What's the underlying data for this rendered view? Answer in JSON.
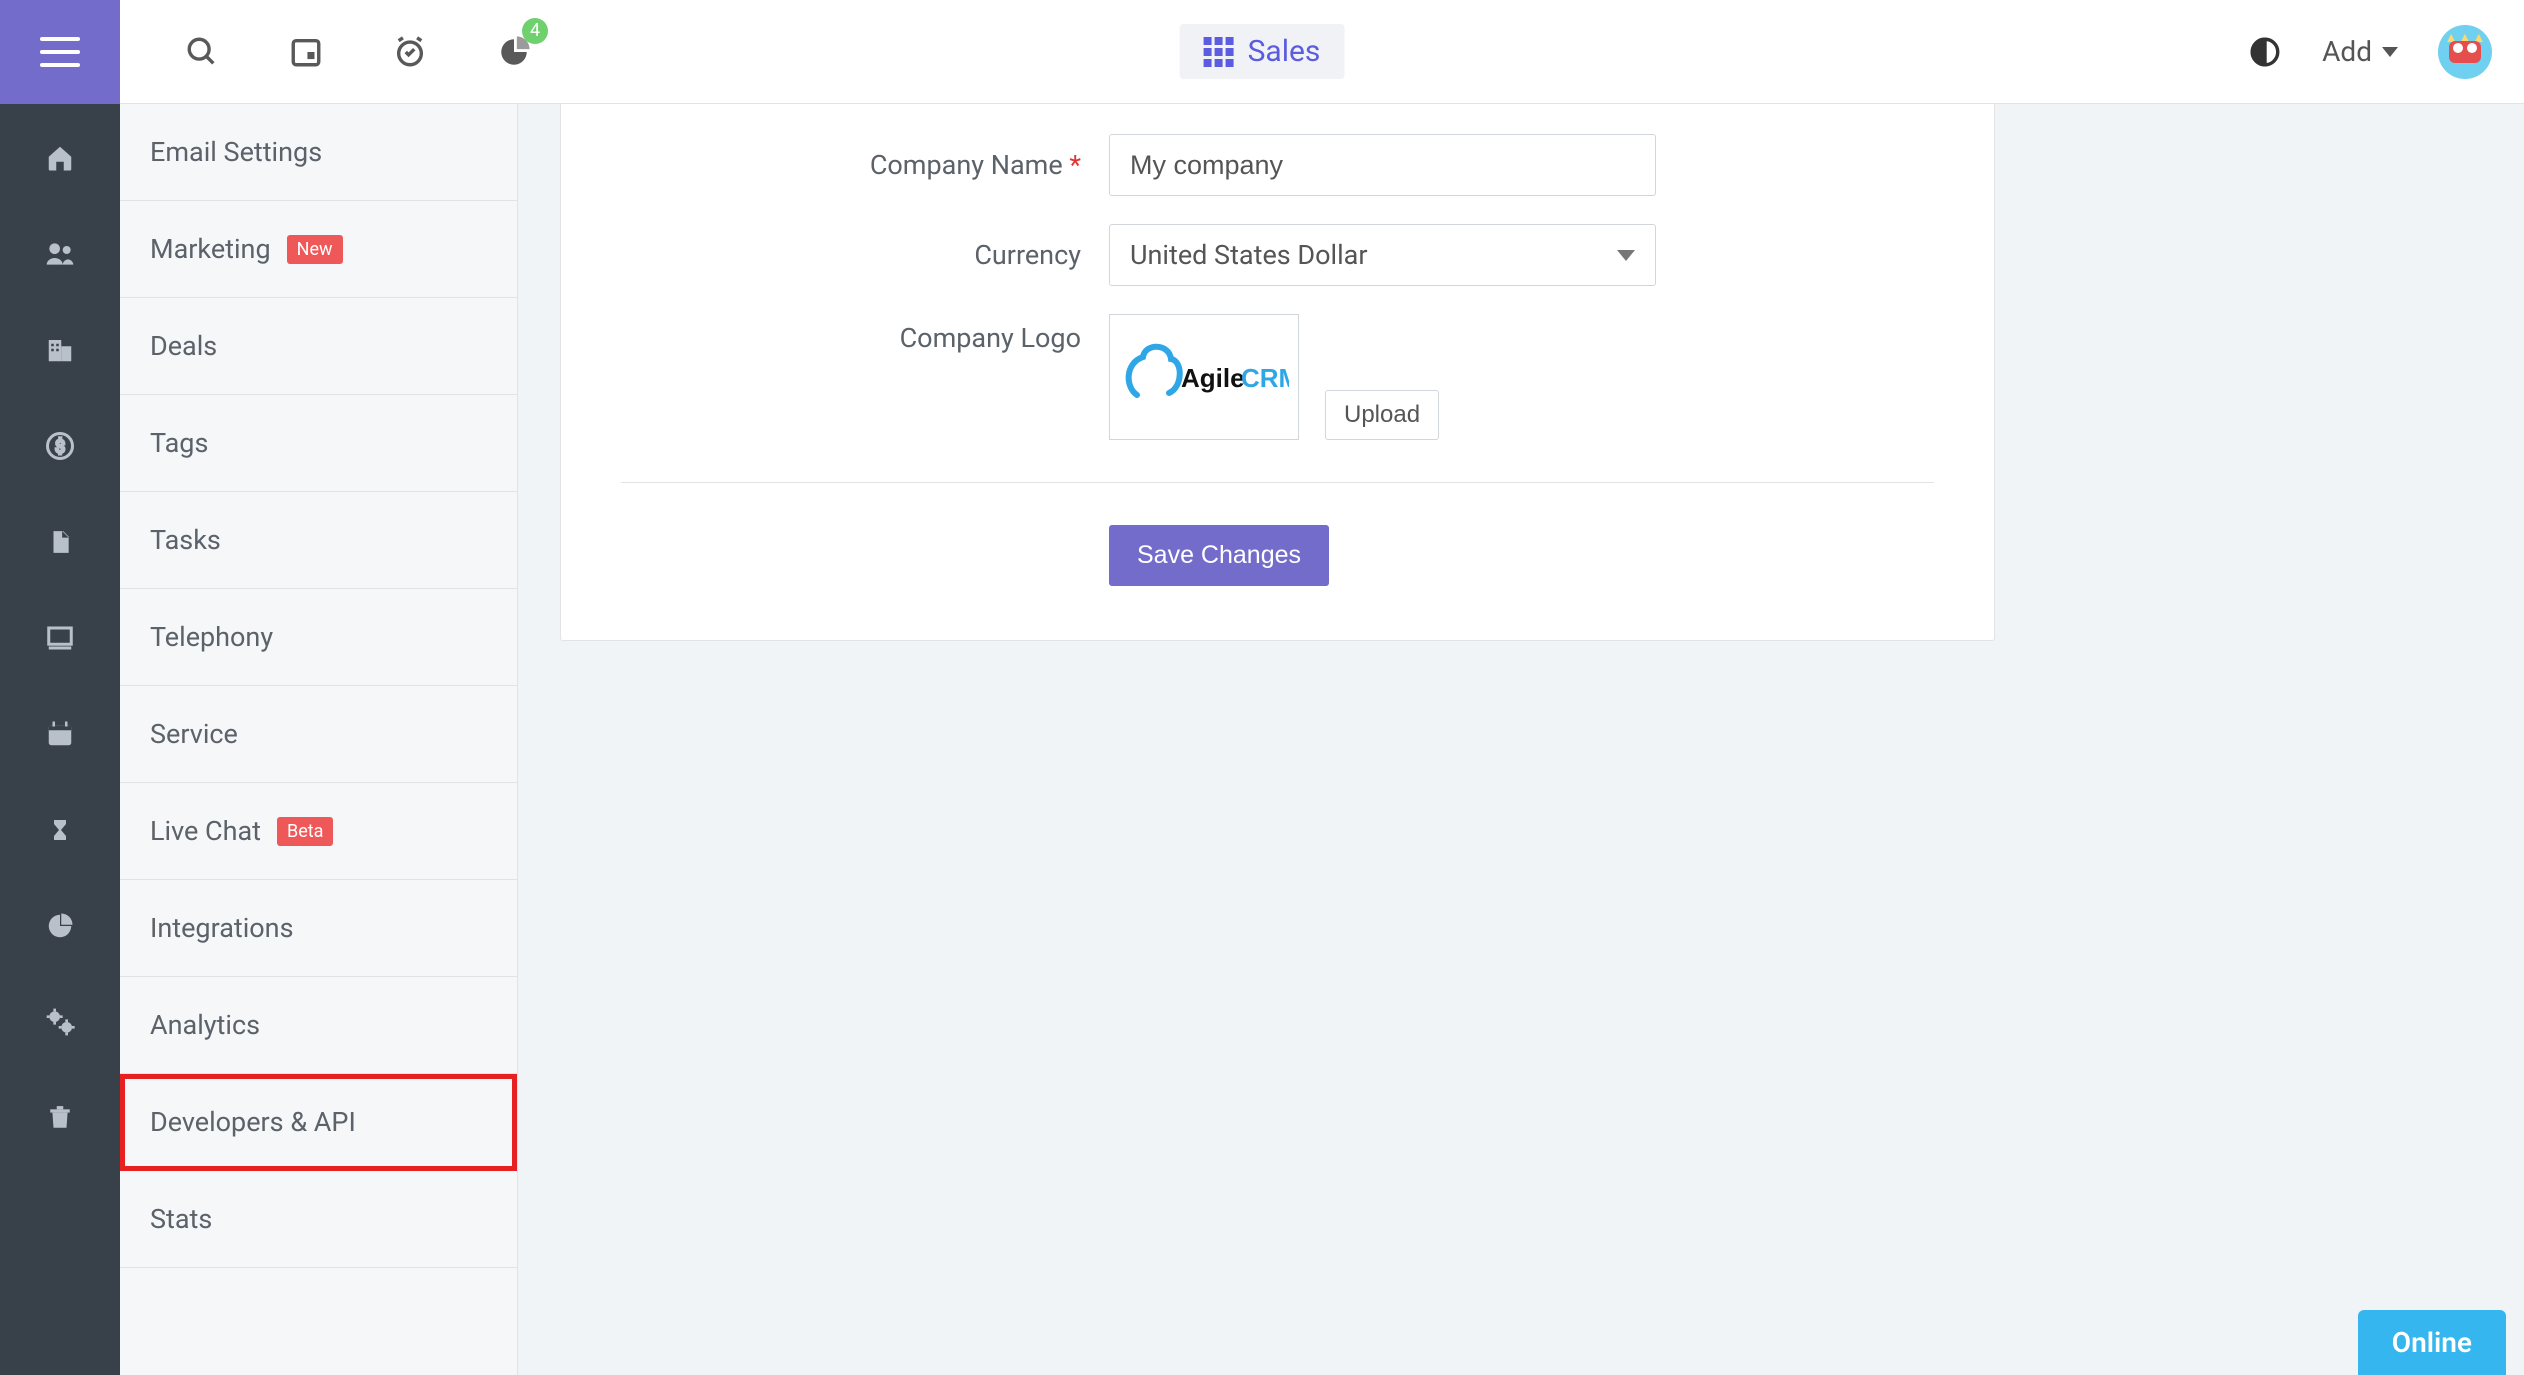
{
  "header": {
    "pill_label": "Sales",
    "notification_count": "4",
    "add_label": "Add"
  },
  "settings_sidebar": {
    "items": [
      {
        "label": "Email Settings",
        "tag": null,
        "highlight": false
      },
      {
        "label": "Marketing",
        "tag": "New",
        "highlight": false
      },
      {
        "label": "Deals",
        "tag": null,
        "highlight": false
      },
      {
        "label": "Tags",
        "tag": null,
        "highlight": false
      },
      {
        "label": "Tasks",
        "tag": null,
        "highlight": false
      },
      {
        "label": "Telephony",
        "tag": null,
        "highlight": false
      },
      {
        "label": "Service",
        "tag": null,
        "highlight": false
      },
      {
        "label": "Live Chat",
        "tag": "Beta",
        "highlight": false
      },
      {
        "label": "Integrations",
        "tag": null,
        "highlight": false
      },
      {
        "label": "Analytics",
        "tag": null,
        "highlight": false
      },
      {
        "label": "Developers & API",
        "tag": null,
        "highlight": true
      },
      {
        "label": "Stats",
        "tag": null,
        "highlight": false
      }
    ]
  },
  "form": {
    "company_name_label": "Company Name",
    "company_name_value": "My company",
    "currency_label": "Currency",
    "currency_value": "United States Dollar",
    "logo_label": "Company Logo",
    "logo_text": "AgileCRM",
    "upload_label": "Upload",
    "save_label": "Save Changes"
  },
  "status": {
    "online_label": "Online"
  },
  "icons": {
    "rail": [
      "home",
      "contacts",
      "companies",
      "deals",
      "docs",
      "desk",
      "calendar",
      "hourglass",
      "reports",
      "settings",
      "trash"
    ]
  }
}
